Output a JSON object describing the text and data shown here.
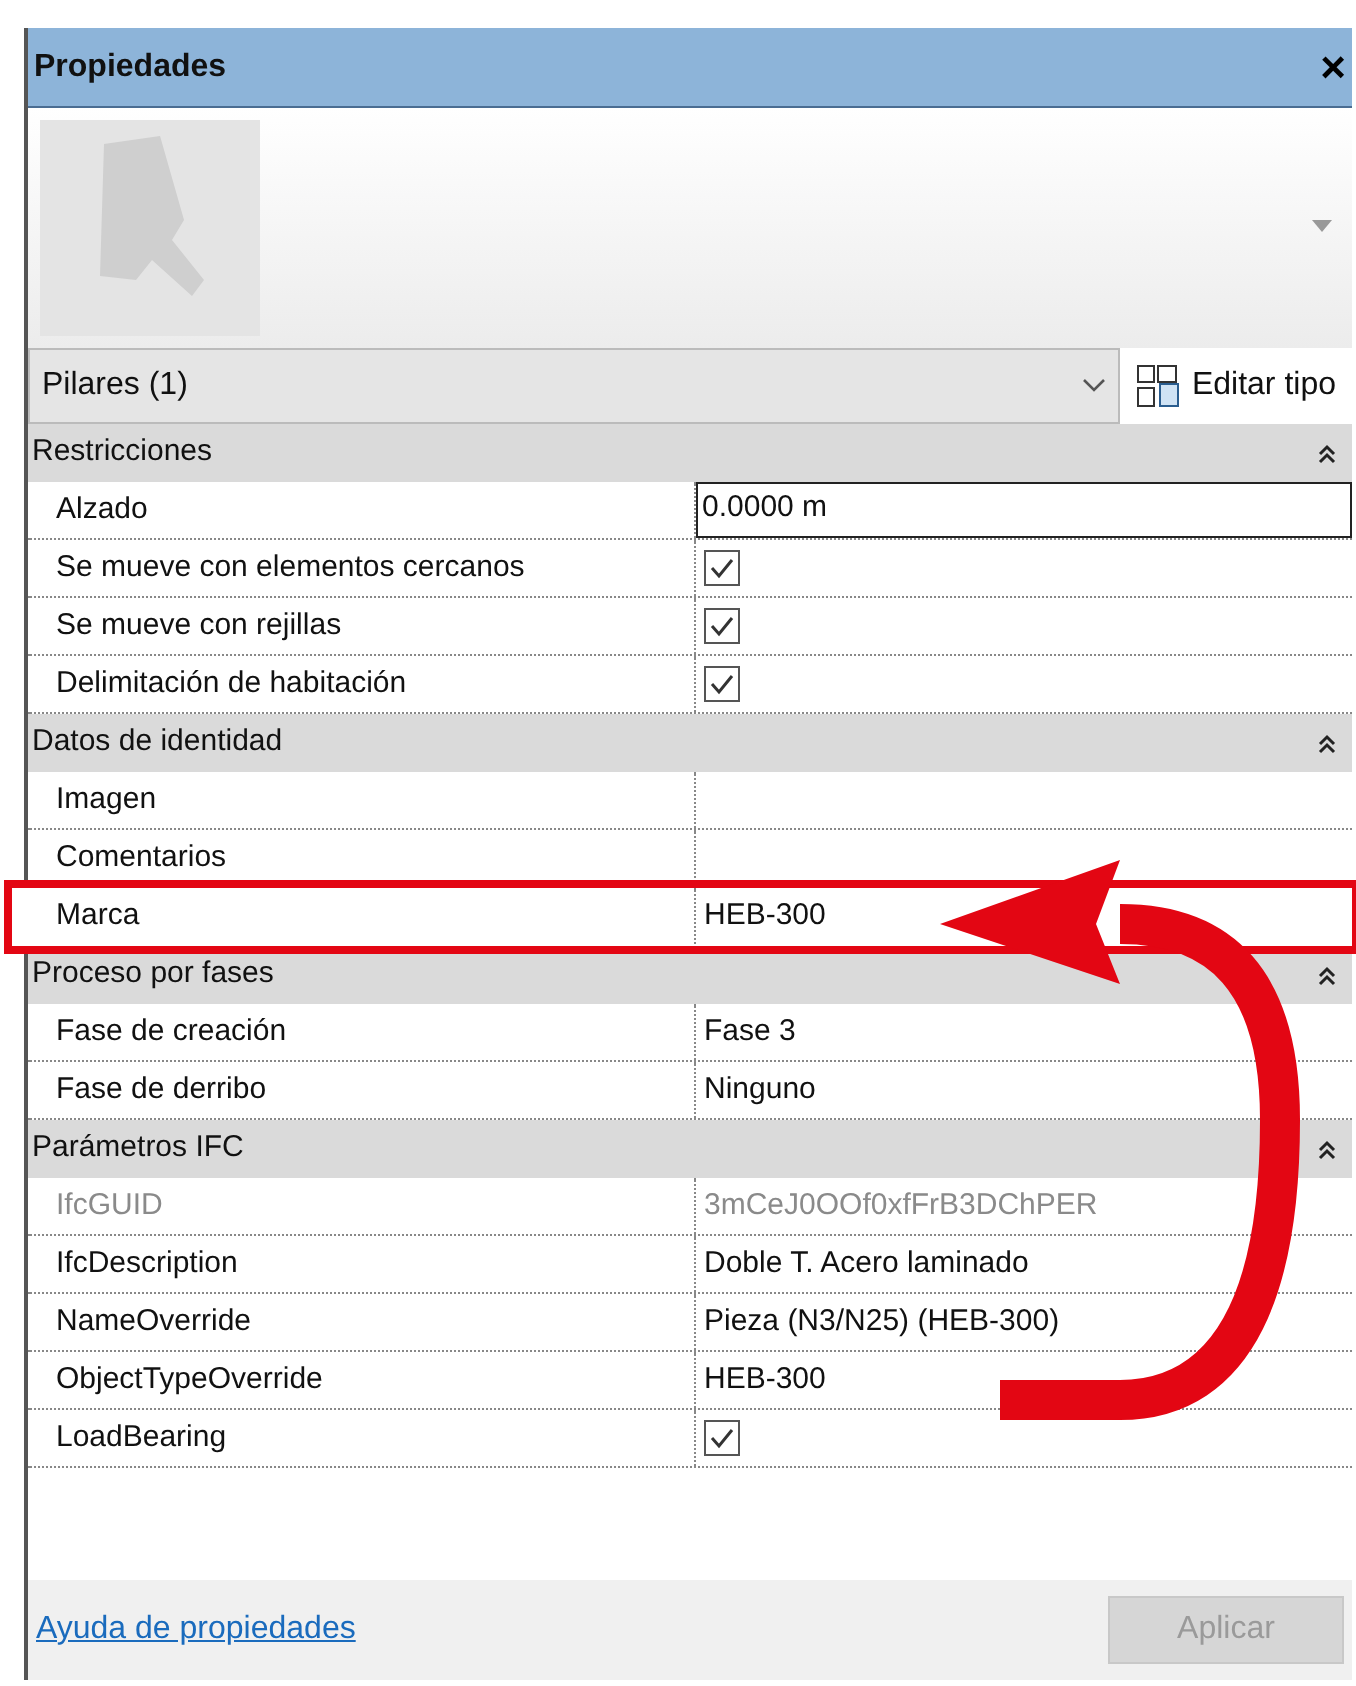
{
  "window": {
    "title": "Propiedades",
    "close": "×"
  },
  "type_selector": {
    "value": "Pilares (1)",
    "edit_type_label": "Editar tipo"
  },
  "groups": [
    {
      "title": "Restricciones",
      "expanded": true,
      "rows": [
        {
          "label": "Alzado",
          "kind": "field",
          "value": "0.0000 m",
          "highlighted": false,
          "disabled": false
        },
        {
          "label": "Se mueve con elementos cercanos",
          "kind": "checkbox",
          "checked": true,
          "highlighted": false,
          "disabled": false
        },
        {
          "label": "Se mueve con rejillas",
          "kind": "checkbox",
          "checked": true,
          "highlighted": false,
          "disabled": false
        },
        {
          "label": "Delimitación de habitación",
          "kind": "checkbox",
          "checked": true,
          "highlighted": false,
          "disabled": false
        }
      ]
    },
    {
      "title": "Datos de identidad",
      "expanded": true,
      "rows": [
        {
          "label": "Imagen",
          "kind": "text",
          "highlighted": false,
          "disabled": false
        },
        {
          "label": "Comentarios",
          "kind": "text",
          "highlighted": false,
          "disabled": false
        },
        {
          "label": "Marca",
          "kind": "text",
          "value": "HEB-300",
          "highlighted": true,
          "disabled": false
        }
      ]
    },
    {
      "title": "Proceso por fases",
      "expanded": true,
      "rows": [
        {
          "label": "Fase de creación",
          "kind": "text",
          "value": "Fase 3",
          "highlighted": false,
          "disabled": false
        },
        {
          "label": "Fase de derribo",
          "kind": "text",
          "value": "Ninguno",
          "highlighted": false,
          "disabled": false
        }
      ]
    },
    {
      "title": "Parámetros IFC",
      "expanded": true,
      "rows": [
        {
          "label": "IfcGUID",
          "kind": "text",
          "value": "3mCeJ0OOf0xfFrB3DChPER",
          "highlighted": false,
          "disabled": true
        },
        {
          "label": "IfcDescription",
          "kind": "text",
          "value": "Doble T. Acero laminado",
          "highlighted": false,
          "disabled": false
        },
        {
          "label": "NameOverride",
          "kind": "text",
          "value": "Pieza (N3/N25) (HEB-300)",
          "highlighted": false,
          "disabled": false
        },
        {
          "label": "ObjectTypeOverride",
          "kind": "text",
          "value": "HEB-300",
          "highlighted": false,
          "disabled": false
        },
        {
          "label": "LoadBearing",
          "kind": "checkbox",
          "checked": true,
          "highlighted": false,
          "disabled": false
        }
      ]
    }
  ],
  "footer": {
    "help_link": "Ayuda de propiedades",
    "apply_button": "Aplicar",
    "apply_disabled": true
  }
}
